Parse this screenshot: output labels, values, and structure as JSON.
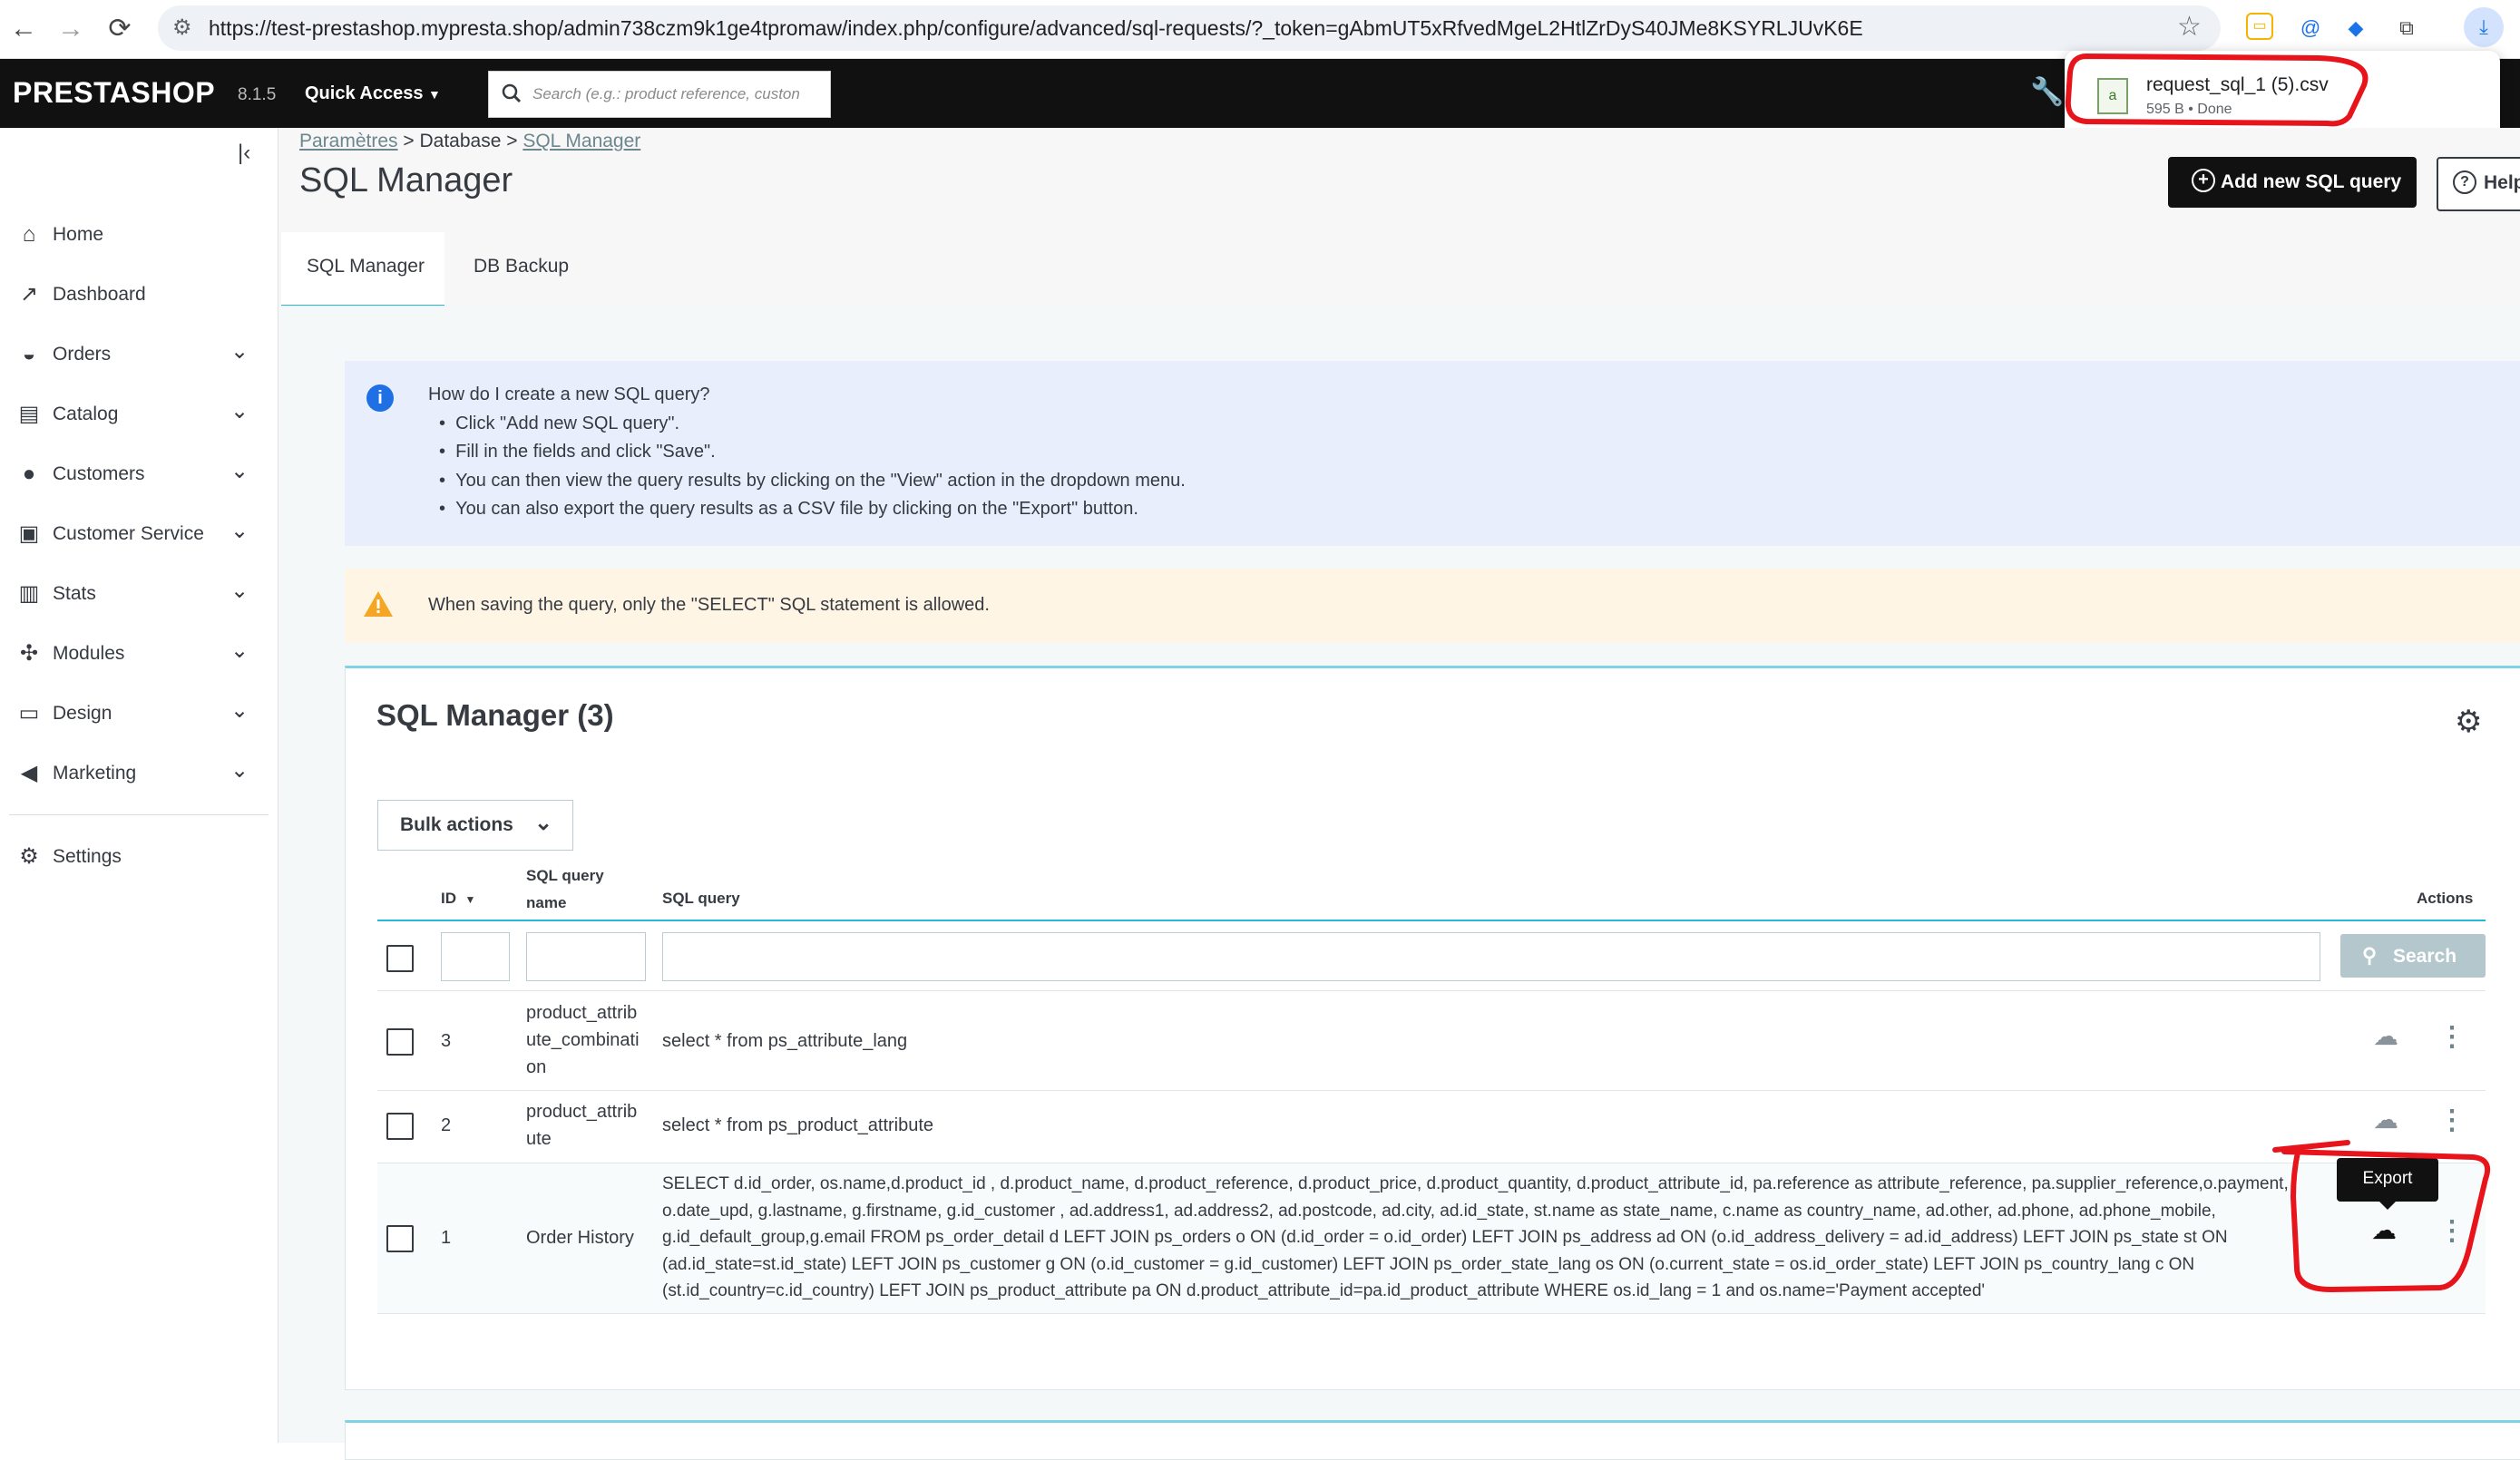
{
  "browser": {
    "url": "https://test-prestashop.mypresta.shop/admin738czm9k1ge4tpromaw/index.php/configure/advanced/sql-requests/?_token=gAbmUT5xRfvedMgeL2HtlZrDyS40JMe8KSYRLJUvK6E"
  },
  "download": {
    "filename": "request_sql_1 (5).csv",
    "meta": "595 B • Done"
  },
  "header": {
    "logo": "PRESTASHOP",
    "version": "8.1.5",
    "quick_access": "Quick Access",
    "search_placeholder": "Search (e.g.: product reference, custon"
  },
  "sidebar": {
    "items": [
      {
        "label": "Home",
        "icon": "home-icon"
      },
      {
        "label": "Dashboard",
        "icon": "trending-icon"
      },
      {
        "label": "Orders",
        "icon": "basket-icon"
      },
      {
        "label": "Catalog",
        "icon": "store-icon"
      },
      {
        "label": "Customers",
        "icon": "user-icon"
      },
      {
        "label": "Customer Service",
        "icon": "chat-icon"
      },
      {
        "label": "Stats",
        "icon": "bar-chart-icon"
      },
      {
        "label": "Modules",
        "icon": "puzzle-icon"
      },
      {
        "label": "Design",
        "icon": "monitor-icon"
      },
      {
        "label": "Marketing",
        "icon": "megaphone-icon"
      },
      {
        "label": "Settings",
        "icon": "gear-icon"
      }
    ]
  },
  "breadcrumb": {
    "first": "Paramètres",
    "sep1": " > ",
    "second": "Database",
    "sep2": " > ",
    "third": "SQL Manager"
  },
  "page": {
    "title": "SQL Manager",
    "add_button": "Add new SQL query",
    "help_button": "Help"
  },
  "tabs": [
    {
      "label": "SQL Manager"
    },
    {
      "label": "DB Backup"
    }
  ],
  "info": {
    "question": "How do I create a new SQL query?",
    "bullets": [
      "Click \"Add new SQL query\".",
      "Fill in the fields and click \"Save\".",
      "You can then view the query results by clicking on the \"View\" action in the dropdown menu.",
      "You can also export the query results as a CSV file by clicking on the \"Export\" button."
    ]
  },
  "warning": {
    "text": "When saving the query, only the \"SELECT\" SQL statement is allowed."
  },
  "card": {
    "title": "SQL Manager (3)",
    "bulk_actions": "Bulk actions",
    "search_button": "Search"
  },
  "table": {
    "headers": {
      "id": "ID",
      "name": "SQL query name",
      "query": "SQL query",
      "actions": "Actions"
    },
    "rows": [
      {
        "id": "3",
        "name": "product_attribute_combination",
        "query": "select * from ps_attribute_lang"
      },
      {
        "id": "2",
        "name": "product_attribute",
        "query": "select * from ps_product_attribute"
      },
      {
        "id": "1",
        "name": "Order History",
        "query": "SELECT d.id_order, os.name,d.product_id , d.product_name, d.product_reference, d.product_price, d.product_quantity, d.product_attribute_id, pa.reference as attribute_reference, pa.supplier_reference,o.payment, o.date_upd, g.lastname, g.firstname, g.id_customer , ad.address1, ad.address2, ad.postcode, ad.city, ad.id_state, st.name as state_name, c.name as country_name, ad.other, ad.phone, ad.phone_mobile, g.id_default_group,g.email FROM ps_order_detail d LEFT JOIN ps_orders o ON (d.id_order = o.id_order) LEFT JOIN ps_address ad ON (o.id_address_delivery = ad.id_address) LEFT JOIN ps_state st ON (ad.id_state=st.id_state) LEFT JOIN ps_customer g ON (o.id_customer = g.id_customer) LEFT JOIN ps_order_state_lang os ON (o.current_state = os.id_order_state) LEFT JOIN ps_country_lang c ON (st.id_country=c.id_country) LEFT JOIN ps_product_attribute pa ON d.product_attribute_id=pa.id_product_attribute WHERE os.id_lang = 1 and os.name='Payment accepted'"
      }
    ]
  },
  "tooltip": {
    "text": "Export"
  },
  "colors": {
    "header_bg": "#111111",
    "accent": "#25b9d7",
    "info_bg": "#e8eefc",
    "warning_bg": "#fff5e5",
    "annotation": "#e8141c"
  }
}
